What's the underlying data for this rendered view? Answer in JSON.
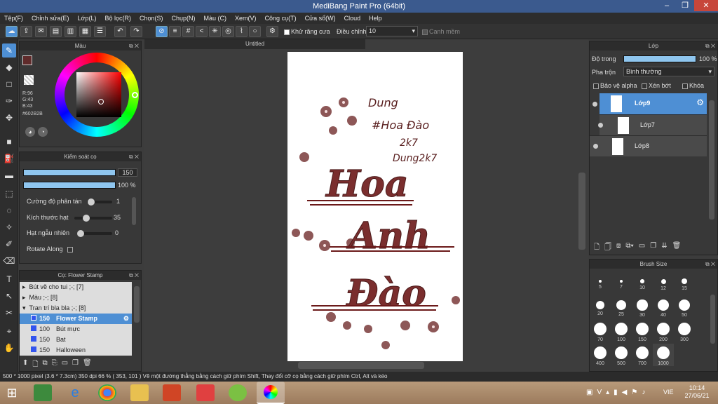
{
  "app": {
    "title": "MediBang Paint Pro (64bit)"
  },
  "window_controls": {
    "minimize": "–",
    "restore": "❐",
    "close": "✕"
  },
  "menu": [
    "Tệp(F)",
    "Chỉnh sửa(E)",
    "Lớp(L)",
    "Bộ lọc(R)",
    "Chọn(S)",
    "Chụp(N)",
    "Màu (C)",
    "Xem(V)",
    "Công cụ(T)",
    "Cửa sổ(W)",
    "Cloud",
    "Help"
  ],
  "toolbar": {
    "antialias_label": "Khử răng cưa",
    "adjust_label": "Điều chỉnh",
    "adjust_value": "10",
    "edge_label": "Canh mềm"
  },
  "color_panel": {
    "title": "Màu",
    "r": "R:96",
    "g": "G:43",
    "b": "B:43",
    "hex": "#602B2B",
    "primary": "#602B2B"
  },
  "brush_control": {
    "title": "Kiểm soát cọ",
    "size_value": "150",
    "opacity_value": "100 %",
    "scatter_label": "Cường độ phân tán",
    "scatter_value": "1",
    "particle_label": "Kích thước hạt",
    "particle_value": "35",
    "random_label": "Hạt ngẫu nhiên",
    "random_value": "0",
    "rotate_label": "Rotate Along"
  },
  "brush_list": {
    "title": "Cọ: Flower Stamp",
    "groups": [
      {
        "label": "Bút vẽ cho tui ;-; [7]"
      },
      {
        "label": "Màu ;-; [8]"
      },
      {
        "label": "Tran trí bla bla ;-; [8]"
      }
    ],
    "items": [
      {
        "size": "150",
        "name": "Flower Stamp"
      },
      {
        "size": "100",
        "name": "Bút mực"
      },
      {
        "size": "150",
        "name": "Bat"
      },
      {
        "size": "150",
        "name": "Halloween"
      }
    ]
  },
  "canvas": {
    "tab": "Untitled",
    "text_lines": [
      "Hoa",
      "Anh",
      "Đào"
    ],
    "scribble": [
      "Dung",
      "#Hoa Đào",
      "2k7",
      "Dung2k7"
    ]
  },
  "layers": {
    "title": "Lớp",
    "opacity_label": "Độ trong",
    "opacity_value": "100 %",
    "blend_label": "Pha trộn",
    "blend_value": "Bình thường",
    "protect_alpha": "Bảo vệ alpha",
    "clipping": "Xén bớt",
    "lock": "Khóa",
    "items": [
      {
        "name": "Lớp9"
      },
      {
        "name": "Lớp7"
      },
      {
        "name": "Lớp8"
      }
    ]
  },
  "brush_size": {
    "title": "Brush Size",
    "sizes": [
      "5",
      "7",
      "10",
      "12",
      "15",
      "20",
      "25",
      "30",
      "40",
      "50",
      "70",
      "100",
      "150",
      "200",
      "300",
      "400",
      "500",
      "700",
      "1000"
    ]
  },
  "status": {
    "text": "500 * 1000 pixel   (3.6 * 7.3cm)   350 dpi   66 %   ( 353, 101 )   Vẽ một đường thẳng bằng cách giữ phím Shift, Thay đổi cỡ cọ bằng cách giữ phím Ctrl, Alt và kéo"
  },
  "taskbar": {
    "lang": "VIE",
    "time": "10:14",
    "date": "27/06/21"
  }
}
